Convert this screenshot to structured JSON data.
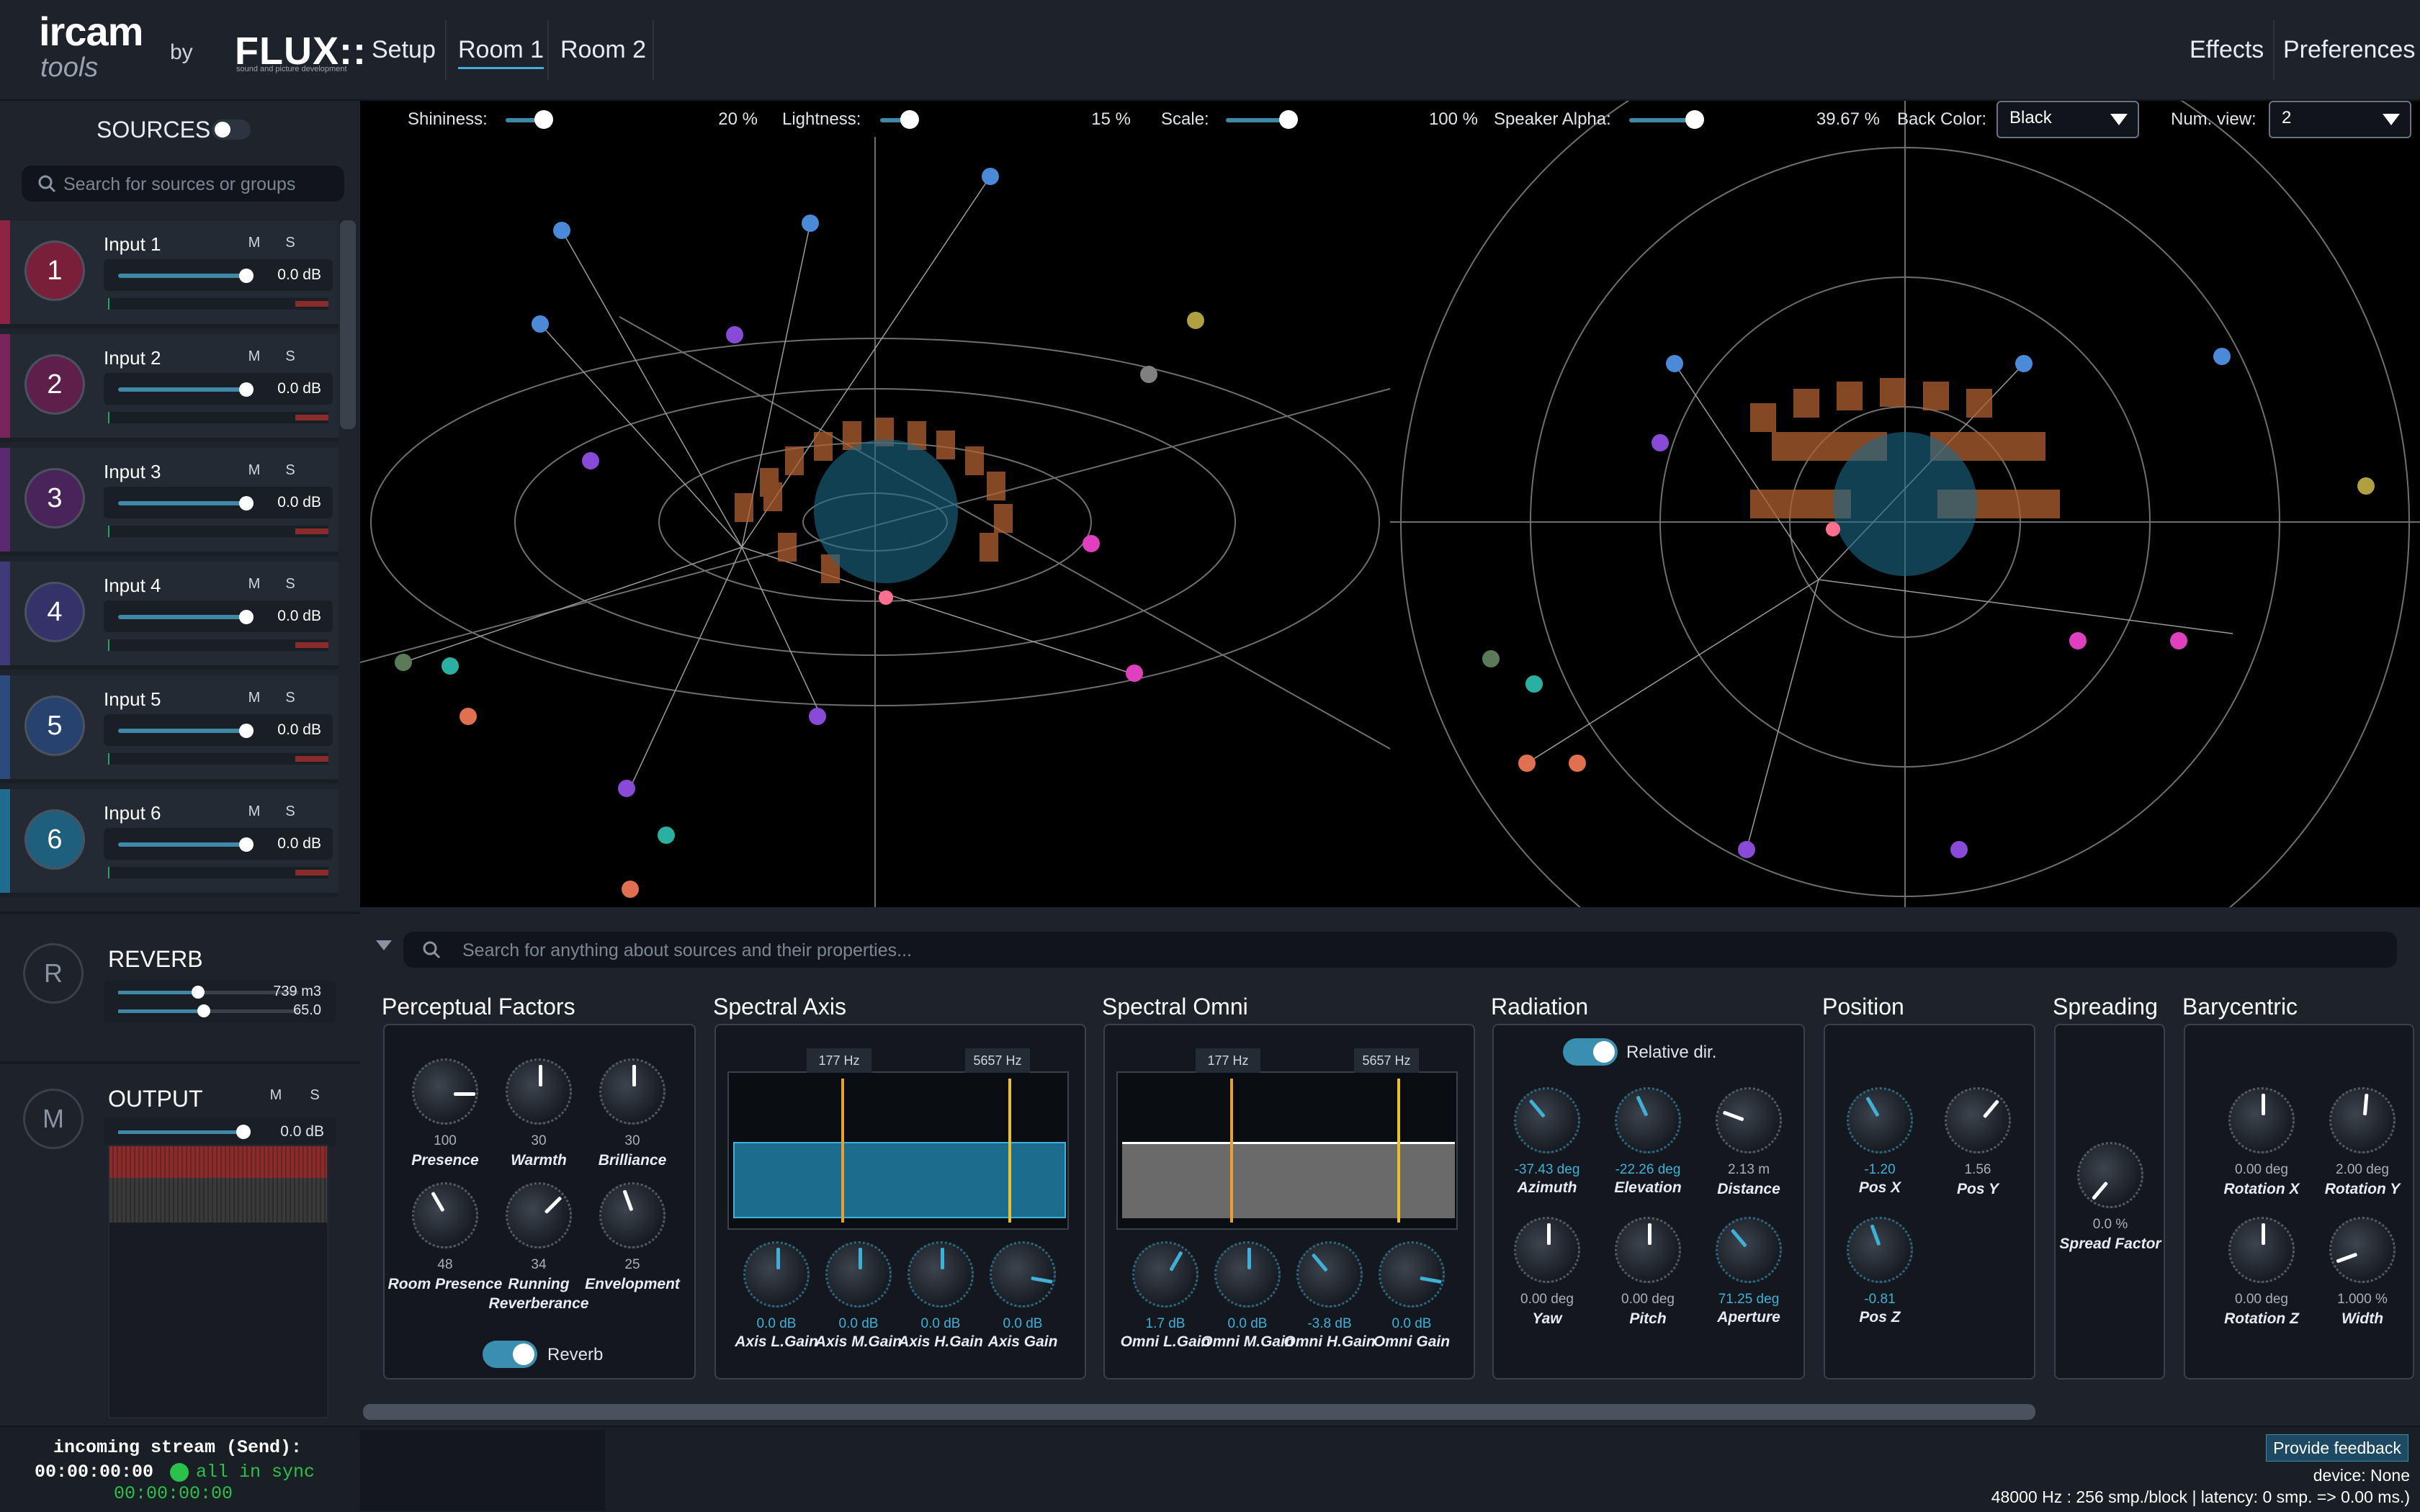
{
  "brand": {
    "ircam": "ircam",
    "tools": "tools",
    "by": "by",
    "flux": "FLUX::",
    "flux_sub": "sound and picture development"
  },
  "menu": {
    "setup": "Setup",
    "room1": "Room 1",
    "room2": "Room 2",
    "effects": "Effects",
    "preferences": "Preferences"
  },
  "sources": {
    "title": "SOURCES",
    "search_placeholder": "Search for sources or groups",
    "mute_label": "M",
    "solo_label": "S",
    "items": [
      {
        "num": "1",
        "name": "Input 1",
        "gain": "0.0 dB",
        "color": "#8e2443",
        "badge": "#7a1f3a"
      },
      {
        "num": "2",
        "name": "Input 2",
        "gain": "0.0 dB",
        "color": "#7a2559",
        "badge": "#5e1f4a"
      },
      {
        "num": "3",
        "name": "Input 3",
        "gain": "0.0 dB",
        "color": "#5a2a6e",
        "badge": "#49245a"
      },
      {
        "num": "4",
        "name": "Input 4",
        "gain": "0.0 dB",
        "color": "#413a78",
        "badge": "#35326a"
      },
      {
        "num": "5",
        "name": "Input 5",
        "gain": "0.0 dB",
        "color": "#2d4a7c",
        "badge": "#284270"
      },
      {
        "num": "6",
        "name": "Input 6",
        "gain": "0.0 dB",
        "color": "#1f6c8e",
        "badge": "#1e5f7e"
      }
    ]
  },
  "reverb": {
    "badge": "R",
    "title": "REVERB",
    "volume": "739 m3",
    "time": "65.0"
  },
  "output": {
    "badge": "M",
    "title": "OUTPUT",
    "gain": "0.0 dB",
    "mute_label": "M",
    "solo_label": "S"
  },
  "viewport": {
    "shininess_label": "Shininess:",
    "shininess_value": "20 %",
    "lightness_label": "Lightness:",
    "lightness_value": "15 %",
    "scale_label": "Scale:",
    "scale_value": "100 %",
    "alpha_label": "Speaker Alpha:",
    "alpha_value": "39.67 %",
    "backcolor_label": "Back Color:",
    "backcolor_value": "Black",
    "numview_label": "Num. view:",
    "numview_value": "2"
  },
  "properties": {
    "search_placeholder": "Search for anything about sources and their properties...",
    "perceptual": {
      "title": "Perceptual Factors",
      "knobs": [
        {
          "value": "100",
          "label": "Presence"
        },
        {
          "value": "30",
          "label": "Warmth"
        },
        {
          "value": "30",
          "label": "Brilliance"
        },
        {
          "value": "48",
          "label": "Room Presence"
        },
        {
          "value": "34",
          "label": "Running Reverberance"
        },
        {
          "value": "25",
          "label": "Envelopment"
        }
      ],
      "reverb_toggle": "Reverb"
    },
    "spectral_axis": {
      "title": "Spectral Axis",
      "freq_low": "177 Hz",
      "freq_high": "5657 Hz",
      "knobs": [
        {
          "value": "0.0 dB",
          "label": "Axis L.Gain"
        },
        {
          "value": "0.0 dB",
          "label": "Axis M.Gain"
        },
        {
          "value": "0.0 dB",
          "label": "Axis H.Gain"
        },
        {
          "value": "0.0 dB",
          "label": "Axis Gain"
        }
      ]
    },
    "spectral_omni": {
      "title": "Spectral Omni",
      "freq_low": "177 Hz",
      "freq_high": "5657 Hz",
      "knobs": [
        {
          "value": "1.7 dB",
          "label": "Omni L.Gain"
        },
        {
          "value": "0.0 dB",
          "label": "Omni M.Gain"
        },
        {
          "value": "-3.8 dB",
          "label": "Omni H.Gain"
        },
        {
          "value": "0.0 dB",
          "label": "Omni Gain"
        }
      ]
    },
    "radiation": {
      "title": "Radiation",
      "toggle": "Relative dir.",
      "knobs": [
        {
          "value": "-37.43 deg",
          "label": "Azimuth"
        },
        {
          "value": "-22.26 deg",
          "label": "Elevation"
        },
        {
          "value": "2.13 m",
          "label": "Distance"
        },
        {
          "value": "0.00 deg",
          "label": "Yaw"
        },
        {
          "value": "0.00 deg",
          "label": "Pitch"
        },
        {
          "value": "71.25 deg",
          "label": "Aperture"
        }
      ]
    },
    "position": {
      "title": "Position",
      "knobs": [
        {
          "value": "-1.20",
          "label": "Pos X"
        },
        {
          "value": "1.56",
          "label": "Pos Y"
        },
        {
          "value": "-0.81",
          "label": "Pos Z"
        }
      ]
    },
    "spreading": {
      "title": "Spreading",
      "knobs": [
        {
          "value": "0.0 %",
          "label": "Spread Factor"
        }
      ]
    },
    "barycentric": {
      "title": "Barycentric",
      "knobs": [
        {
          "value": "0.00 deg",
          "label": "Rotation X"
        },
        {
          "value": "2.00 deg",
          "label": "Rotation Y"
        },
        {
          "value": "0.00 deg",
          "label": "Rotation Z"
        },
        {
          "value": "1.000 %",
          "label": "Width"
        }
      ]
    }
  },
  "status": {
    "stream_label": "incoming stream (Send):",
    "time1": "00:00:00:00",
    "sync": "all in sync",
    "time2": "00:00:00:00",
    "feedback": "Provide feedback",
    "device": "device: None",
    "audio_info": "48000 Hz : 256 smp./block | latency: 0 smp. => 0.00 ms.)"
  },
  "colors": {
    "accent": "#3f88a8",
    "accent_light": "#3fb1d8",
    "sync_green": "#29c24a",
    "meter_red": "#8a2c2c"
  }
}
